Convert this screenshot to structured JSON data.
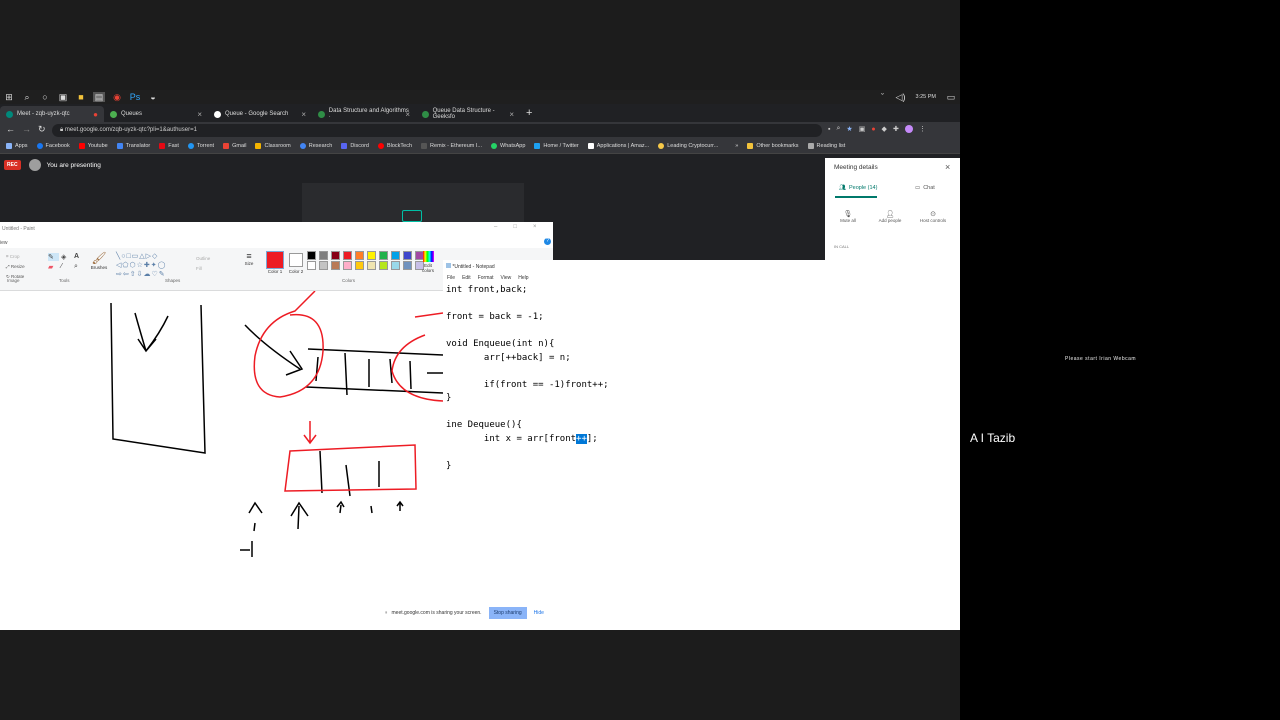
{
  "taskbar": {
    "time": "3:25 PM"
  },
  "tabs": [
    {
      "label": "Meet - zqb-uyzk-qtc",
      "color": "#00897b",
      "active": true
    },
    {
      "label": "Queues",
      "color": "#4caf50",
      "active": false
    },
    {
      "label": "Queue - Google Search",
      "color": "#4285f4",
      "active": false
    },
    {
      "label": "Data Structure and Algorithms ·",
      "color": "#2f8d46",
      "active": false
    },
    {
      "label": "Queue Data Structure - Geeksfo",
      "color": "#2f8d46",
      "active": false
    }
  ],
  "address": {
    "url": "meet.google.com/zqb-uyzk-qtc?pli=1&authuser=1"
  },
  "bookmarks": {
    "items": [
      "Apps",
      "Facebook",
      "Youtube",
      "Translator",
      "Fast",
      "Torrent",
      "Gmail",
      "Classroom",
      "Research",
      "Discord",
      "BlockTech",
      "Remix - Ethereum I...",
      "WhatsApp",
      "Home / Twitter",
      "Applications | Amaz...",
      "Leading Cryptocurr..."
    ],
    "more": "»",
    "other": "Other bookmarks",
    "reading": "Reading list"
  },
  "presenting": {
    "rec": "REC",
    "text": "You are presenting"
  },
  "meeting": {
    "title": "Meeting details",
    "people_tab": "People (14)",
    "chat_tab": "Chat",
    "mute_all": "Mute all",
    "add_people": "Add people",
    "host_controls": "Host controls",
    "in_call": "IN CALL"
  },
  "paint": {
    "title": "Untitled - Paint",
    "view": "iew",
    "crop": "Crop",
    "resize": "Resize",
    "rotate": "Rotate",
    "brushes": "Brushes",
    "outline": "Outline",
    "fill": "Fill",
    "size": "Size",
    "color1": "Color 1",
    "color2": "Color 2",
    "edit_colors": "Edit colors",
    "group_image": "Image",
    "group_tools": "Tools",
    "group_shapes": "Shapes",
    "group_colors": "Colors",
    "palette": [
      "#000000",
      "#7f7f7f",
      "#880015",
      "#ed1c24",
      "#ff7f27",
      "#fff200",
      "#22b14c",
      "#00a2e8",
      "#3f48cc",
      "#a349a4",
      "#ffffff",
      "#c3c3c3",
      "#b97a57",
      "#ffaec9",
      "#ffc90e",
      "#efe4b0",
      "#b5e61d",
      "#99d9ea",
      "#7092be",
      "#c8bfe7"
    ],
    "accent": "#ed1c24"
  },
  "notepad": {
    "title": "*Untitled - Notepad",
    "menu": [
      "File",
      "Edit",
      "Format",
      "View",
      "Help"
    ],
    "code_before": "int front,back;\n\nfront = back = -1;\n\nvoid Enqueue(int n){\n       arr[++back] = n;\n\n       if(front == -1)front++;\n}\n\nine Dequeue(){\n       int x = arr[front",
    "code_selected": "++",
    "code_after": "];\n\n}"
  },
  "share": {
    "text": "meet.google.com is sharing your screen.",
    "stop": "Stop sharing",
    "hide": "Hide"
  },
  "right_panel": {
    "webcam_msg": "Please start Irian Webcam",
    "name": "A I Tazib"
  }
}
